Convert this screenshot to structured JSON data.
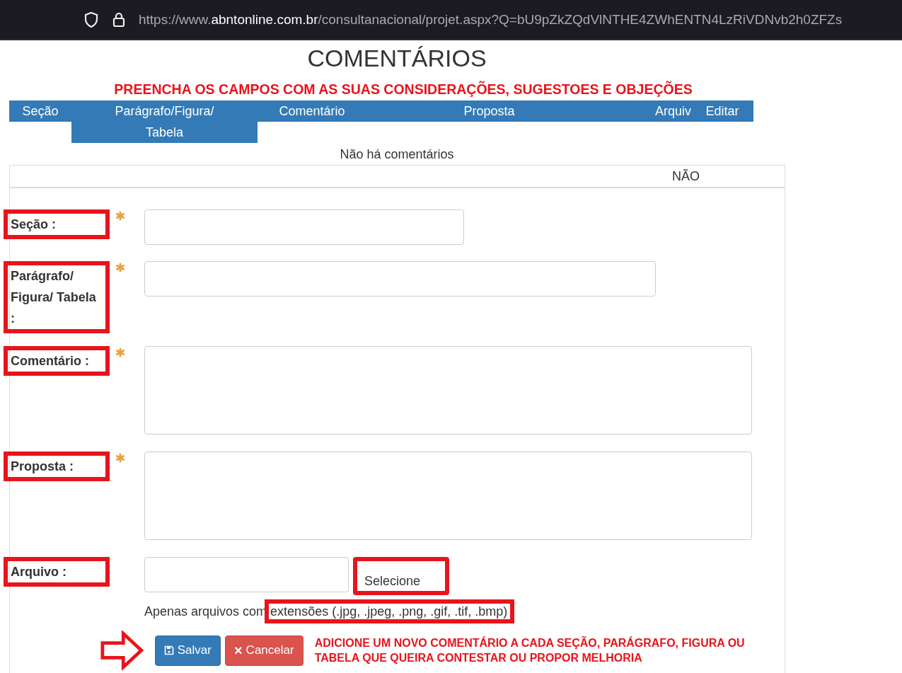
{
  "browser": {
    "url_host_prefix": "https://www.",
    "url_domain": "abntonline.com.br",
    "url_path": "/consultanacional/projet.aspx?Q=bU9pZkZQdVlNTHE4ZWhENTN4LzRiVDNvb2h0ZFZs"
  },
  "page_title": "COMENTÁRIOS",
  "instruction": "PREENCHA OS CAMPOS COM AS SUAS CONSIDERAÇÕES, SUGESTOES E OBJEÇÕES",
  "columns": [
    {
      "label": "Seção"
    },
    {
      "label": "Parágrafo/Figura/ Tabela"
    },
    {
      "label": "Comentário"
    },
    {
      "label": "Proposta"
    },
    {
      "label": "Arquiv"
    },
    {
      "label": "Editar"
    }
  ],
  "empty_message": "Não há comentários",
  "table_header_cell": "NÃO",
  "fields": [
    {
      "kind": "input",
      "label": "Seção :",
      "required": true,
      "highlighted": true
    },
    {
      "kind": "input",
      "label": "Parágrafo/ Figura/ Tabela :",
      "required": true,
      "highlighted": true
    },
    {
      "kind": "textarea",
      "label": "Comentário :",
      "required": true,
      "highlighted": true
    },
    {
      "kind": "textarea",
      "label": "Proposta :",
      "required": true,
      "highlighted": true
    },
    {
      "kind": "file",
      "label": "Arquivo :",
      "required": false,
      "highlighted": true,
      "button": "Selecione",
      "button_highlighted": true
    }
  ],
  "file_hint": "Apenas arquivos com",
  "file_hint_highlighted": "extensões (.jpg, .jpeg, .png, .gif, .tif, .bmp)",
  "buttons": [
    {
      "kind": "primary",
      "label": "Salvar"
    },
    {
      "kind": "danger",
      "label": "Cancelar",
      "icon": "×"
    }
  ],
  "note": "ADICIONE UM NOVO COMENTÁRIO A CADA SEÇÃO, PARÁGRAFO, FIGURA OU TABELA QUE QUEIRA CONTESTAR OU PROPOR MELHORIA"
}
